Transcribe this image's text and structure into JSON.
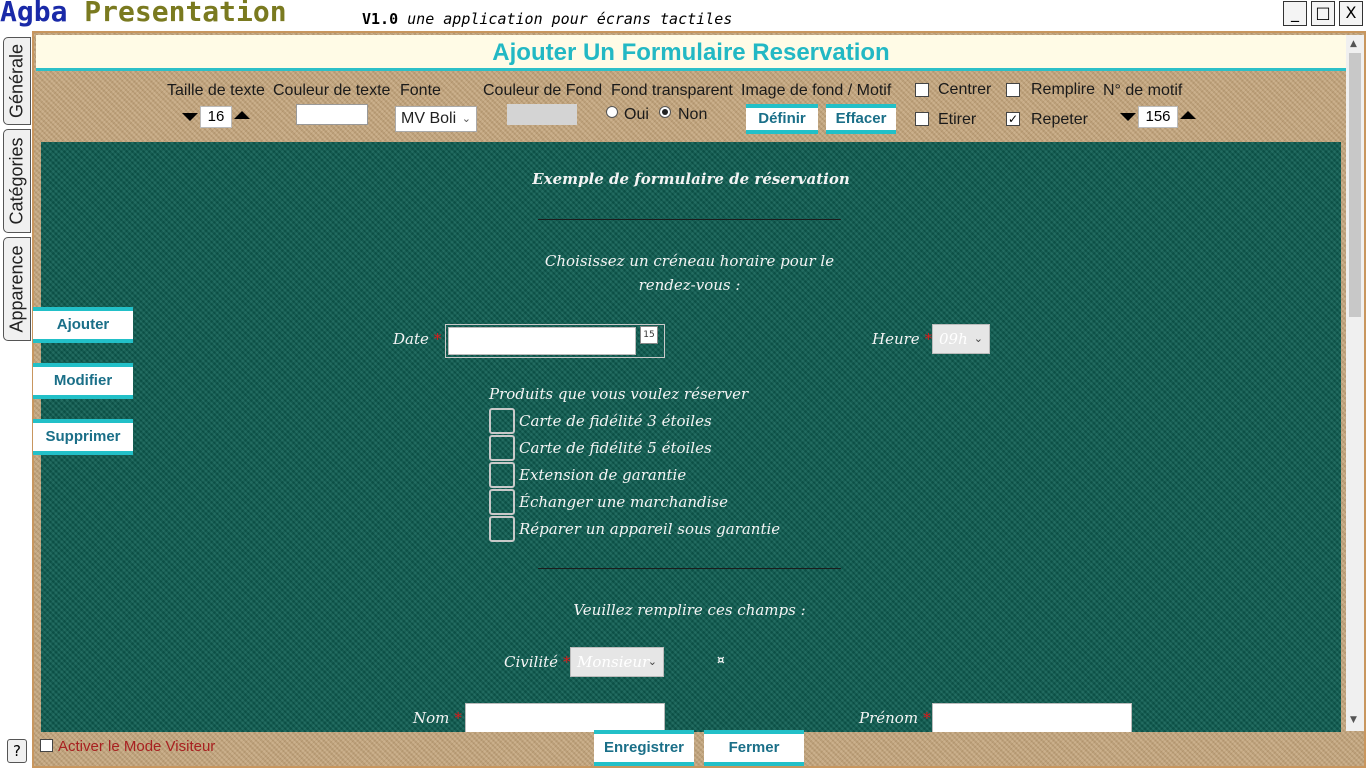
{
  "titlebar": {
    "app_name_part1": "Agba",
    "app_name_part2": "Presentation",
    "version": "V1.0",
    "tagline": "une application pour écrans tactiles",
    "minimize": "_",
    "maximize": "□",
    "close": "X"
  },
  "side_tabs": [
    "Générale",
    "Catégories",
    "Apparence"
  ],
  "help_label": "?",
  "page_title": "Ajouter Un Formulaire Reservation",
  "toolbar": {
    "text_size_label": "Taille de texte",
    "text_size_value": "16",
    "text_color_label": "Couleur de texte",
    "font_label": "Fonte",
    "font_value": "MV Boli",
    "bg_color_label": "Couleur de Fond",
    "transparent_label": "Fond transparent",
    "transparent_yes": "Oui",
    "transparent_no": "Non",
    "transparent_selected": "Non",
    "bg_image_label": "Image de fond / Motif",
    "define_button": "Définir",
    "clear_button": "Effacer",
    "center_label": "Centrer",
    "stretch_label": "Etirer",
    "fill_label": "Remplire",
    "repeat_label": "Repeter",
    "repeat_checked": true,
    "pattern_number_label": "N° de motif",
    "pattern_number_value": "156",
    "colors": {
      "accent": "#22c0c8",
      "title": "#22b8c4",
      "canvas_bg": "#0e5e52",
      "panel_bg": "#c4a57c"
    }
  },
  "form": {
    "title": "Exemple de formulaire de réservation",
    "slot_prompt_line1": "Choisissez un créneau horaire pour le",
    "slot_prompt_line2": "rendez-vous :",
    "date_label": "Date",
    "calendar_icon_text": "15",
    "hour_label": "Heure",
    "hour_value": "09h",
    "products_heading": "Produits que vous voulez réserver",
    "products": [
      "Carte de fidélité 3 étoiles",
      "Carte de fidélité 5 étoiles",
      "Extension de garantie",
      "Échanger une marchandise",
      "Réparer un appareil sous garantie"
    ],
    "fill_prompt": "Veuillez remplire ces champs :",
    "civility_label": "Civilité",
    "civility_value": "Monsieur",
    "civility_marker": "¤",
    "name_label": "Nom",
    "firstname_label": "Prénom",
    "required_mark": "*"
  },
  "side_buttons": {
    "add": "Ajouter",
    "edit": "Modifier",
    "delete": "Supprimer"
  },
  "footer": {
    "visitor_mode_label": "Activer le Mode Visiteur",
    "save_button": "Enregistrer",
    "close_button": "Fermer"
  }
}
